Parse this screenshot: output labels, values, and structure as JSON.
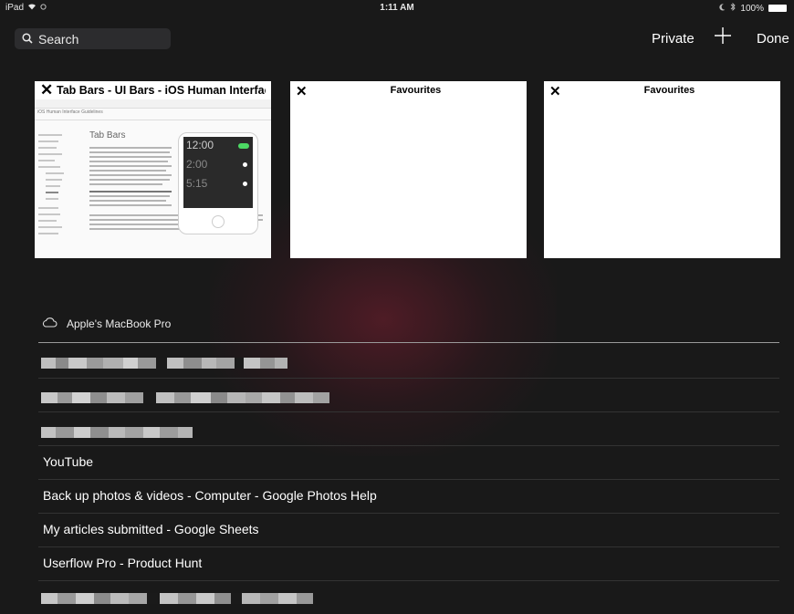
{
  "status_bar": {
    "device": "iPad",
    "time": "1:11 AM",
    "battery": "100%"
  },
  "toolbar": {
    "search_placeholder": "Search",
    "private_label": "Private",
    "add_label": "+",
    "done_label": "Done"
  },
  "tabs": [
    {
      "close": "✕",
      "title": "Tab Bars - UI Bars - iOS Human Interface Guid...",
      "preview_heading": "Tab Bars",
      "preview_subtitle": "iOS Human Interface Guidelines",
      "preview_times": [
        "12:00",
        "2:00",
        "5:15"
      ]
    },
    {
      "close": "✕",
      "title": "Favourites"
    },
    {
      "close": "✕",
      "title": "Favourites"
    }
  ],
  "cloud_tabs": {
    "device_name": "Apple's MacBook Pro",
    "items": [
      "YouTube",
      "Back up photos & videos - Computer - Google Photos Help",
      "My articles submitted - Google Sheets",
      "Userflow Pro - Product Hunt"
    ]
  },
  "icons": {
    "search": "search-icon",
    "cloud": "cloud-icon",
    "close": "close-icon",
    "wifi": "wifi-icon",
    "battery": "battery-icon"
  },
  "colors": {
    "background": "#191919",
    "tab_background": "#ffffff",
    "search_field": "#2c2c2e",
    "divider": "#333333",
    "glow": "#7a1e30"
  }
}
